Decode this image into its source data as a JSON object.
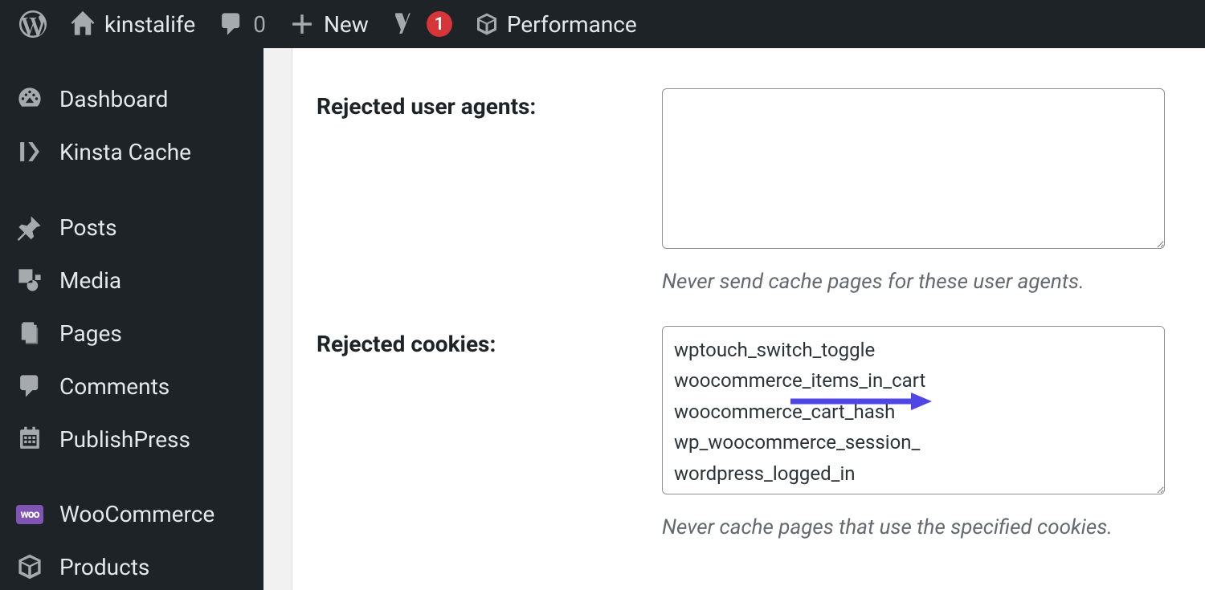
{
  "topbar": {
    "site_name": "kinstalife",
    "comments_count": "0",
    "new_label": "New",
    "yoast_badge": "1",
    "performance_label": "Performance"
  },
  "sidebar": {
    "items": [
      {
        "label": "Dashboard"
      },
      {
        "label": "Kinsta Cache"
      },
      {
        "label": "Posts"
      },
      {
        "label": "Media"
      },
      {
        "label": "Pages"
      },
      {
        "label": "Comments"
      },
      {
        "label": "PublishPress"
      },
      {
        "label": "WooCommerce"
      },
      {
        "label": "Products"
      }
    ]
  },
  "form": {
    "rejected_user_agents": {
      "label": "Rejected user agents:",
      "value": "",
      "help": "Never send cache pages for these user agents."
    },
    "rejected_cookies": {
      "label": "Rejected cookies:",
      "value": "wptouch_switch_toggle\nwoocommerce_items_in_cart\nwoocommerce_cart_hash\nwp_woocommerce_session_\nwordpress_logged_in",
      "help": "Never cache pages that use the specified cookies."
    }
  },
  "colors": {
    "annotation_arrow": "#4f46e5"
  }
}
